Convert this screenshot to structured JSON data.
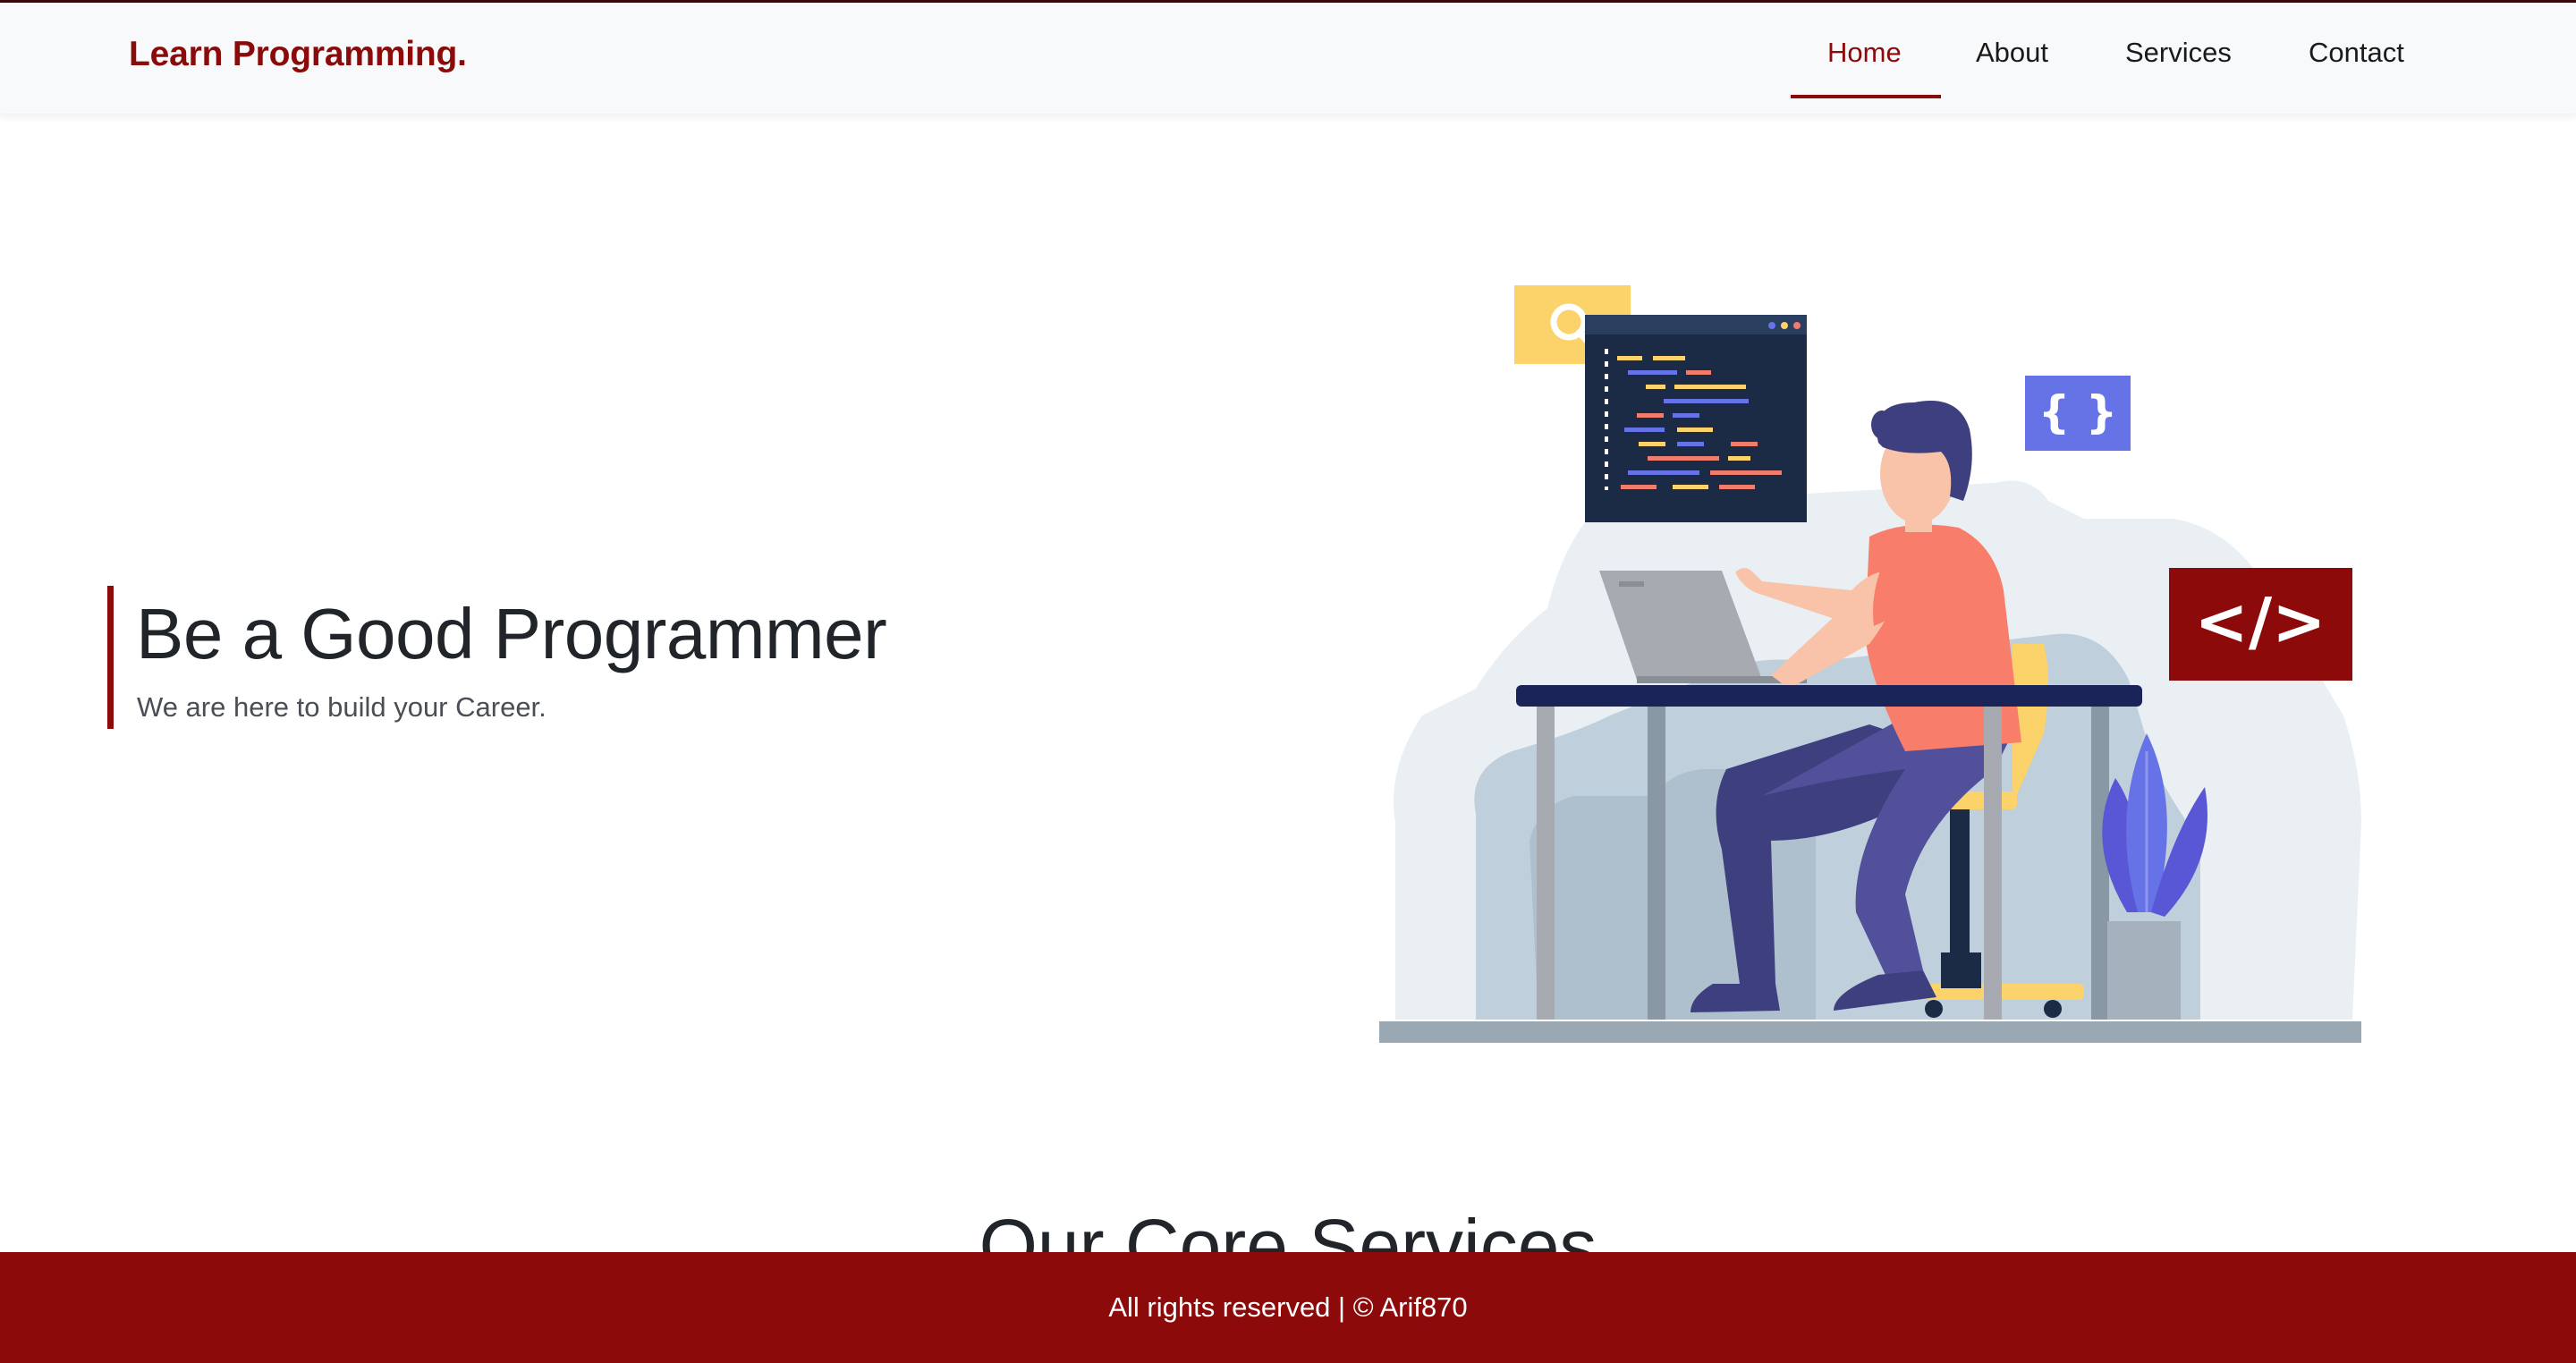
{
  "brand": {
    "label": "Learn Programming."
  },
  "nav": {
    "items": [
      {
        "label": "Home",
        "active": true
      },
      {
        "label": "About",
        "active": false
      },
      {
        "label": "Services",
        "active": false
      },
      {
        "label": "Contact",
        "active": false
      }
    ]
  },
  "hero": {
    "title": "Be a Good Programmer",
    "subtitle": "We are here to build your Career.",
    "illustration": {
      "icon_names": [
        "search-icon",
        "curly-braces-icon",
        "code-tag-icon"
      ],
      "code_tag_text": "</>",
      "braces_text": "{ }"
    }
  },
  "services": {
    "title": "Our Core Services"
  },
  "footer": {
    "text": "All rights reserved | © Arif870"
  },
  "colors": {
    "brand": "#8b0a0a",
    "footer": "#8d0a0b",
    "navbar_bg": "#f8f9fa"
  }
}
